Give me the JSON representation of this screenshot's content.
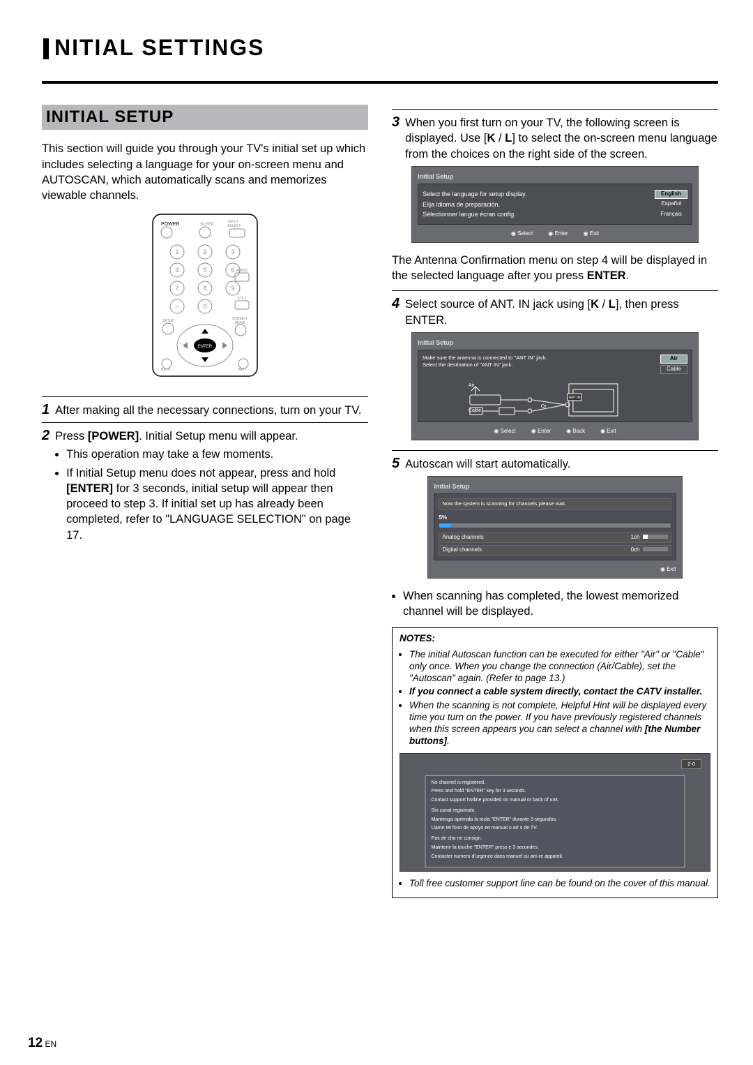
{
  "page_number": "12",
  "lang_code": "EN",
  "heading": "NITIAL SETTINGS",
  "section_title": "INITIAL SETUP",
  "intro": "This section will guide you through your TV's initial set up which includes selecting a language for your on-screen menu and AUTOSCAN, which automatically scans and memorizes viewable channels.",
  "remote": {
    "labels": {
      "power": "POWER",
      "sleep": "SLEEP",
      "input": "INPUT SELECT",
      "audio": "AUDIO",
      "still": "STILL",
      "setup": "SETUP",
      "screen": "SCREEN MODE",
      "enter": "ENTER",
      "back": "BACK",
      "info": "INFO"
    },
    "digits": [
      "1",
      "2",
      "3",
      "4",
      "5",
      "6",
      "7",
      "8",
      "9",
      "0",
      "–"
    ]
  },
  "steps": {
    "1": {
      "num": "1",
      "body": "After making all the necessary connections, turn on your TV."
    },
    "2": {
      "num": "2",
      "body": "Press [POWER]. Initial Setup menu will appear.",
      "bullets": [
        "This operation may take a few moments.",
        "If Initial Setup menu does not appear, press and hold [ENTER] for 3 seconds, initial setup will appear then proceed to step 3. If initial set up has already been completed, refer to \"LANGUAGE SELECTION\" on page 17."
      ]
    },
    "3": {
      "num": "3",
      "body_pre": "When you first turn on your TV, the following screen is displayed. Use [",
      "body_post": "] to select the on-screen menu language from the choices on the right side of the screen.",
      "after": "The Antenna Confirmation menu on step 4 will be displayed in the selected language after you press ENTER."
    },
    "4": {
      "num": "4",
      "body_pre": "Select source of ANT. IN jack using [",
      "body_post": "], then press ENTER."
    },
    "5": {
      "num": "5",
      "body": "Autoscan will start automatically.",
      "bullet": "When scanning has completed, the lowest memorized channel will be displayed."
    }
  },
  "osd_lang": {
    "title": "Initial Setup",
    "rows": [
      {
        "prompt": "Select the language for setup display.",
        "opt": "English",
        "sel": true
      },
      {
        "prompt": "Elija idioma de preparación.",
        "opt": "Español",
        "sel": false
      },
      {
        "prompt": "Sélectionner langue écran config.",
        "opt": "Français",
        "sel": false
      }
    ],
    "foot": [
      "Select",
      "Enter",
      "Exit"
    ]
  },
  "osd_ant": {
    "title": "Initial Setup",
    "line1": "Make sure the antenna is connected to \"ANT IN\" jack.",
    "line2": "Select the destination of \"ANT IN\" jack.",
    "opts": [
      {
        "l": "Air",
        "sel": true
      },
      {
        "l": "Cable",
        "sel": false
      }
    ],
    "diagram": {
      "air": "Air",
      "cable": "Cable",
      "or": "Or",
      "antin": "ANT IN"
    },
    "foot": [
      "Select",
      "Enter",
      "Back",
      "Exit"
    ]
  },
  "osd_scan": {
    "title": "Initial Setup",
    "msg": "Now the system is scanning for channels,please wait.",
    "pct": "5%",
    "rows": [
      {
        "l": "Analog channels",
        "v": "1ch"
      },
      {
        "l": "Digital channels",
        "v": "0ch"
      }
    ],
    "foot": [
      "Exit"
    ]
  },
  "notes": {
    "title": "NOTES:",
    "items": [
      "The initial Autoscan function can be executed for either \"Air\" or \"Cable\" only once. When you change the connection (Air/Cable), set the \"Autoscan\" again. (Refer to page 13.)",
      "If you connect a cable system directly, contact the CATV installer.",
      "When the scanning is not complete, Helpful Hint will be displayed every time you turn on the power. If you have previously registered channels when this screen appears you can select a channel with [the Number buttons].",
      "Toll free customer support line can be found on the cover of this manual."
    ]
  },
  "hint": {
    "ch": "2-0",
    "en": [
      "No channel is registered.",
      "Press and hold \"ENTER\" key for 3 seconds.",
      "Contact support hotline provided on manual or back of unit."
    ],
    "es": [
      "Sin canal registrado.",
      "Mantenga oprimida la tecla \"ENTER\" durante 3 segundos.",
      "Llame tel fono de apoyo en manual o atr s de TV."
    ],
    "fr": [
      "Pas de cha ne consign.",
      "Maintenir la touche \"ENTER\" press e 3 secondes.",
      "Contacter numero d'urgence dans manuel ou arri re appareil."
    ]
  },
  "arrow_keys": "K / L"
}
